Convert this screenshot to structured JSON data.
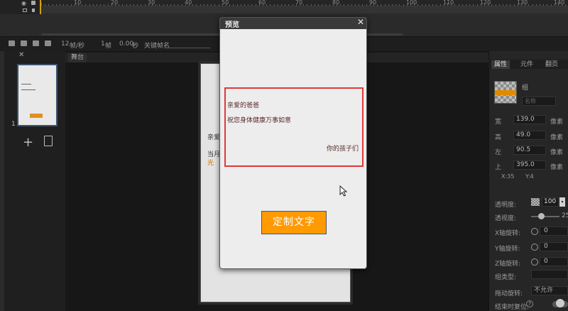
{
  "timeline": {
    "ruler_ticks": [
      "10",
      "20",
      "30",
      "40",
      "50",
      "60",
      "70",
      "80",
      "90",
      "100",
      "110",
      "120",
      "130",
      "140"
    ]
  },
  "controls": {
    "fps": "12",
    "fps_unit": "帧/秒",
    "frame": "1",
    "frame_unit": "帧",
    "time": "0.00",
    "time_unit": "秒",
    "keyframe_label": "关键帧名"
  },
  "pages": {
    "page_number": "1",
    "add_symbol": "+"
  },
  "stage": {
    "tab_label": "舞台",
    "behind_text_1": "亲爱",
    "behind_text_2": "当月",
    "behind_text_3": "光"
  },
  "properties": {
    "tabs": [
      "属性",
      "元件",
      "翻页"
    ],
    "object_type": "组",
    "name_placeholder": "名称",
    "fields": [
      {
        "label": "宽",
        "value": "139.0",
        "unit": "像素"
      },
      {
        "label": "高",
        "value": "49.0",
        "unit": "像素"
      },
      {
        "label": "左",
        "value": "90.5",
        "unit": "像素"
      },
      {
        "label": "上",
        "value": "395.0",
        "unit": "像素"
      }
    ],
    "coord_x": "X:35",
    "coord_y": "Y:4",
    "opacity_label": "透明度:",
    "opacity_value": "100",
    "opacity_button": "▾",
    "blur_label": "透视度:",
    "blur_value": "25",
    "x_rotate_label": "X轴旋转:",
    "x_rotate_value": "0",
    "y_rotate_label": "Y轴旋转:",
    "y_rotate_value": "0",
    "z_rotate_label": "Z轴旋转:",
    "z_rotate_value": "0",
    "group_type_label": "组类型:",
    "drag_label": "拖动旋转:",
    "drag_value": "不允许",
    "end_reset_label": "结束时复位:",
    "help_symbol": "?"
  },
  "dialog": {
    "title": "预览",
    "close": "✕",
    "greeting": "亲爱的爸爸",
    "wish": "祝您身体健康万事如意",
    "signature": "你的孩子们",
    "button_label": "定制文字",
    "highlight_color": "#e0383a",
    "button_color": "#ff9a00"
  }
}
